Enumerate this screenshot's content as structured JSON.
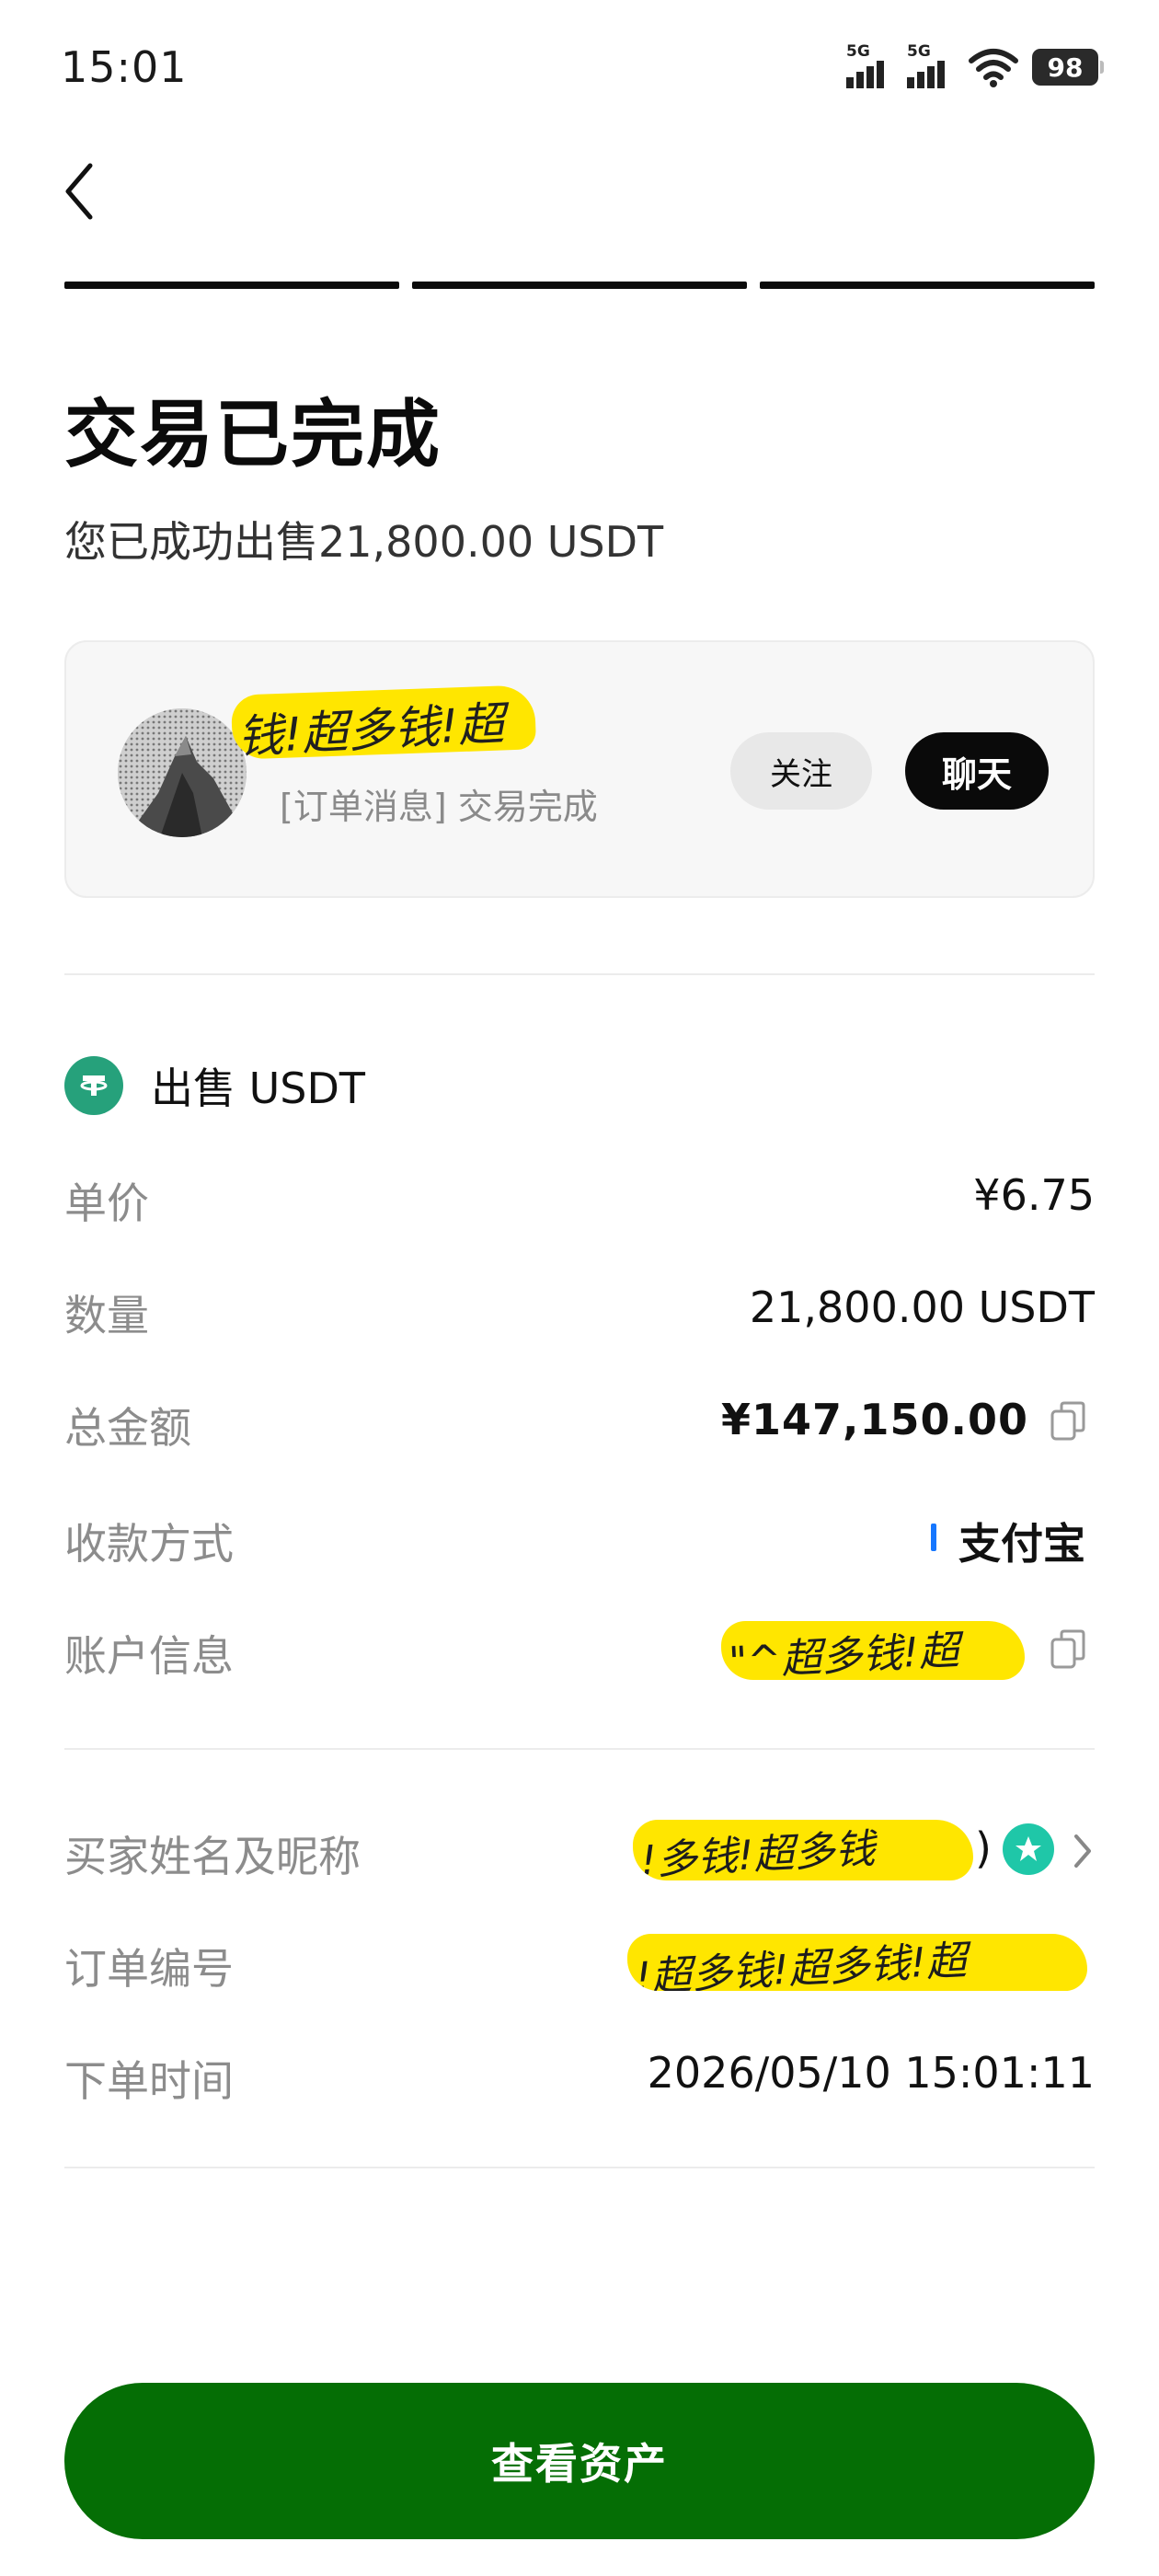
{
  "status_bar": {
    "time": "15:01",
    "signal_1_label": "5G",
    "signal_2_label": "5G",
    "battery": "98"
  },
  "header": {
    "back_icon": "chevron-left-icon",
    "progress_steps": 3
  },
  "title": "交易已完成",
  "subtitle": "您已成功出售21,800.00 USDT",
  "counterparty": {
    "nickname": "钱!超多钱!超",
    "last_message": "[订单消息] 交易完成",
    "follow_label": "关注",
    "chat_label": "聊天"
  },
  "order": {
    "section_title": "出售 USDT",
    "section_icon": "tether-icon",
    "unit_price_label": "单价",
    "unit_price": "¥6.75",
    "quantity_label": "数量",
    "quantity": "21,800.00 USDT",
    "total_label": "总金额",
    "total": "¥147,150.00",
    "payment_method_label": "收款方式",
    "payment_method": "支付宝",
    "account_info_label": "账户信息",
    "account_info": "\"^超多钱!超",
    "buyer_label": "买家姓名及昵称",
    "buyer": "!多钱!超多钱",
    "order_no_label": "订单编号",
    "order_no": "!超多钱!超多钱!超",
    "order_time_label": "下单时间",
    "order_time": "2026/05/10 15:01:11"
  },
  "actions": {
    "view_assets": "查看资产"
  },
  "colors": {
    "primary_button": "#056e05",
    "tether": "#26a17b",
    "alipay": "#1677ff",
    "redaction": "#ffe600",
    "badge": "#1fc7a8"
  }
}
